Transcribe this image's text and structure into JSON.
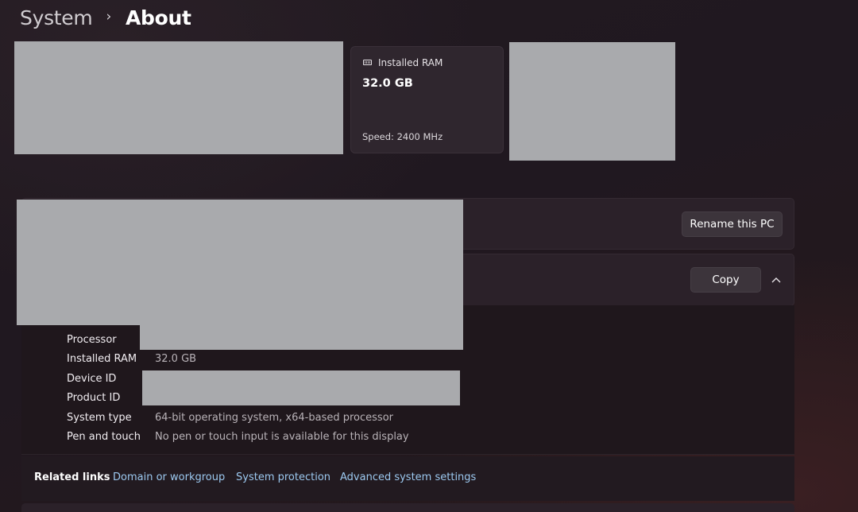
{
  "breadcrumb": {
    "parent": "System",
    "separator": "›",
    "current": "About"
  },
  "ram_card": {
    "icon": "memory-icon",
    "label": "Installed RAM",
    "value": "32.0 GB",
    "speed": "Speed: 2400 MHz"
  },
  "device_panel": {
    "rename_button": "Rename this PC"
  },
  "specs_panel": {
    "copy_button": "Copy",
    "collapse_icon": "chevron-up-icon",
    "rows": [
      {
        "label": "Processor",
        "value": ""
      },
      {
        "label": "Installed RAM",
        "value": "32.0 GB"
      },
      {
        "label": "Device ID",
        "value": ""
      },
      {
        "label": "Product ID",
        "value": ""
      },
      {
        "label": "System type",
        "value": "64-bit operating system, x64-based processor"
      },
      {
        "label": "Pen and touch",
        "value": "No pen or touch input is available for this display"
      }
    ]
  },
  "related_links": {
    "title": "Related links",
    "links": [
      "Domain or workgroup",
      "System protection",
      "Advanced system settings"
    ]
  },
  "colors": {
    "accent_link": "#9cc9f0",
    "redaction": "#a9aaad",
    "background": "#201820"
  }
}
